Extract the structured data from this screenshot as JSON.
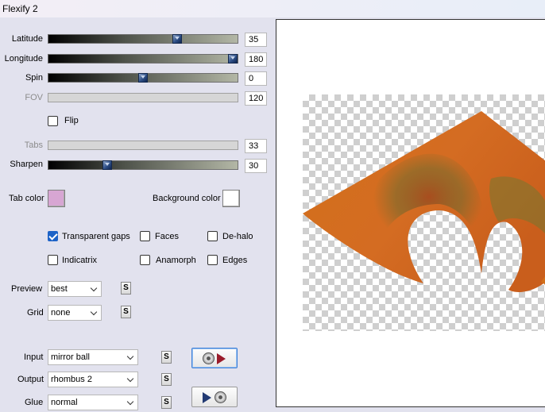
{
  "window": {
    "title": "Flexify 2"
  },
  "sliders": {
    "latitude": {
      "label": "Latitude",
      "value": "35",
      "fraction": 0.68
    },
    "longitude": {
      "label": "Longitude",
      "value": "180",
      "fraction": 0.975
    },
    "spin": {
      "label": "Spin",
      "value": "0",
      "fraction": 0.5
    },
    "fov": {
      "label": "FOV",
      "value": "120"
    },
    "tabs": {
      "label": "Tabs",
      "value": "33"
    },
    "sharpen": {
      "label": "Sharpen",
      "value": "30",
      "fraction": 0.31
    }
  },
  "checkboxes": {
    "flip": {
      "label": "Flip",
      "checked": false
    },
    "transparent_gaps": {
      "label": "Transparent gaps",
      "checked": true
    },
    "faces": {
      "label": "Faces",
      "checked": false
    },
    "de_halo": {
      "label": "De-halo",
      "checked": false
    },
    "indicatrix": {
      "label": "Indicatrix",
      "checked": false
    },
    "anamorph": {
      "label": "Anamorph",
      "checked": false
    },
    "edges": {
      "label": "Edges",
      "checked": false
    }
  },
  "colors": {
    "tab_color_label": "Tab color",
    "tab_color": "#d7a6d3",
    "background_color_label": "Background color",
    "background_color": "#ffffff"
  },
  "dropdowns": {
    "preview": {
      "label": "Preview",
      "value": "best"
    },
    "grid": {
      "label": "Grid",
      "value": "none"
    },
    "input": {
      "label": "Input",
      "value": "mirror ball"
    },
    "output": {
      "label": "Output",
      "value": "rhombus 2"
    },
    "glue": {
      "label": "Glue",
      "value": "normal"
    }
  },
  "small_button_label": "S",
  "icons": {
    "disc": "disc-icon",
    "arrow": "play-arrow-icon"
  }
}
